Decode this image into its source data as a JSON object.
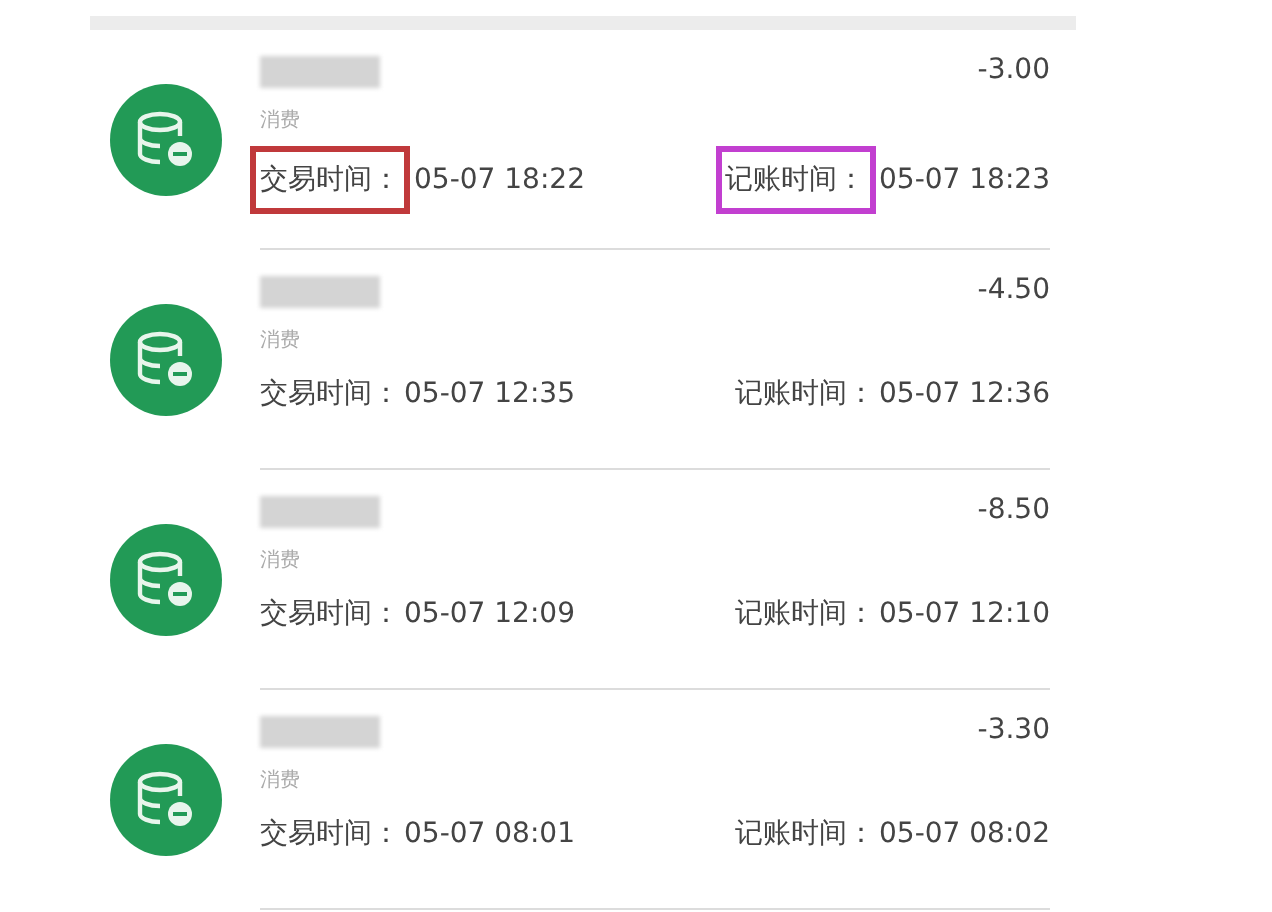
{
  "transactions": [
    {
      "category": "消费",
      "amount": "-3.00",
      "trade": {
        "label": "交易时间：",
        "time": "05-07 18:22",
        "color": "#c0393b"
      },
      "posted": {
        "label": "记账时间：",
        "time": "05-07 18:23",
        "color": "#c23fd0"
      }
    },
    {
      "category": "消费",
      "amount": "-4.50",
      "trade": {
        "label": "交易时间：",
        "time": "05-07 12:35"
      },
      "posted": {
        "label": "记账时间：",
        "time": "05-07 12:36"
      }
    },
    {
      "category": "消费",
      "amount": "-8.50",
      "trade": {
        "label": "交易时间：",
        "time": "05-07 12:09"
      },
      "posted": {
        "label": "记账时间：",
        "time": "05-07 12:10"
      }
    },
    {
      "category": "消费",
      "amount": "-3.30",
      "trade": {
        "label": "交易时间：",
        "time": "05-07 08:01"
      },
      "posted": {
        "label": "记账时间：",
        "time": "05-07 08:02"
      }
    }
  ]
}
